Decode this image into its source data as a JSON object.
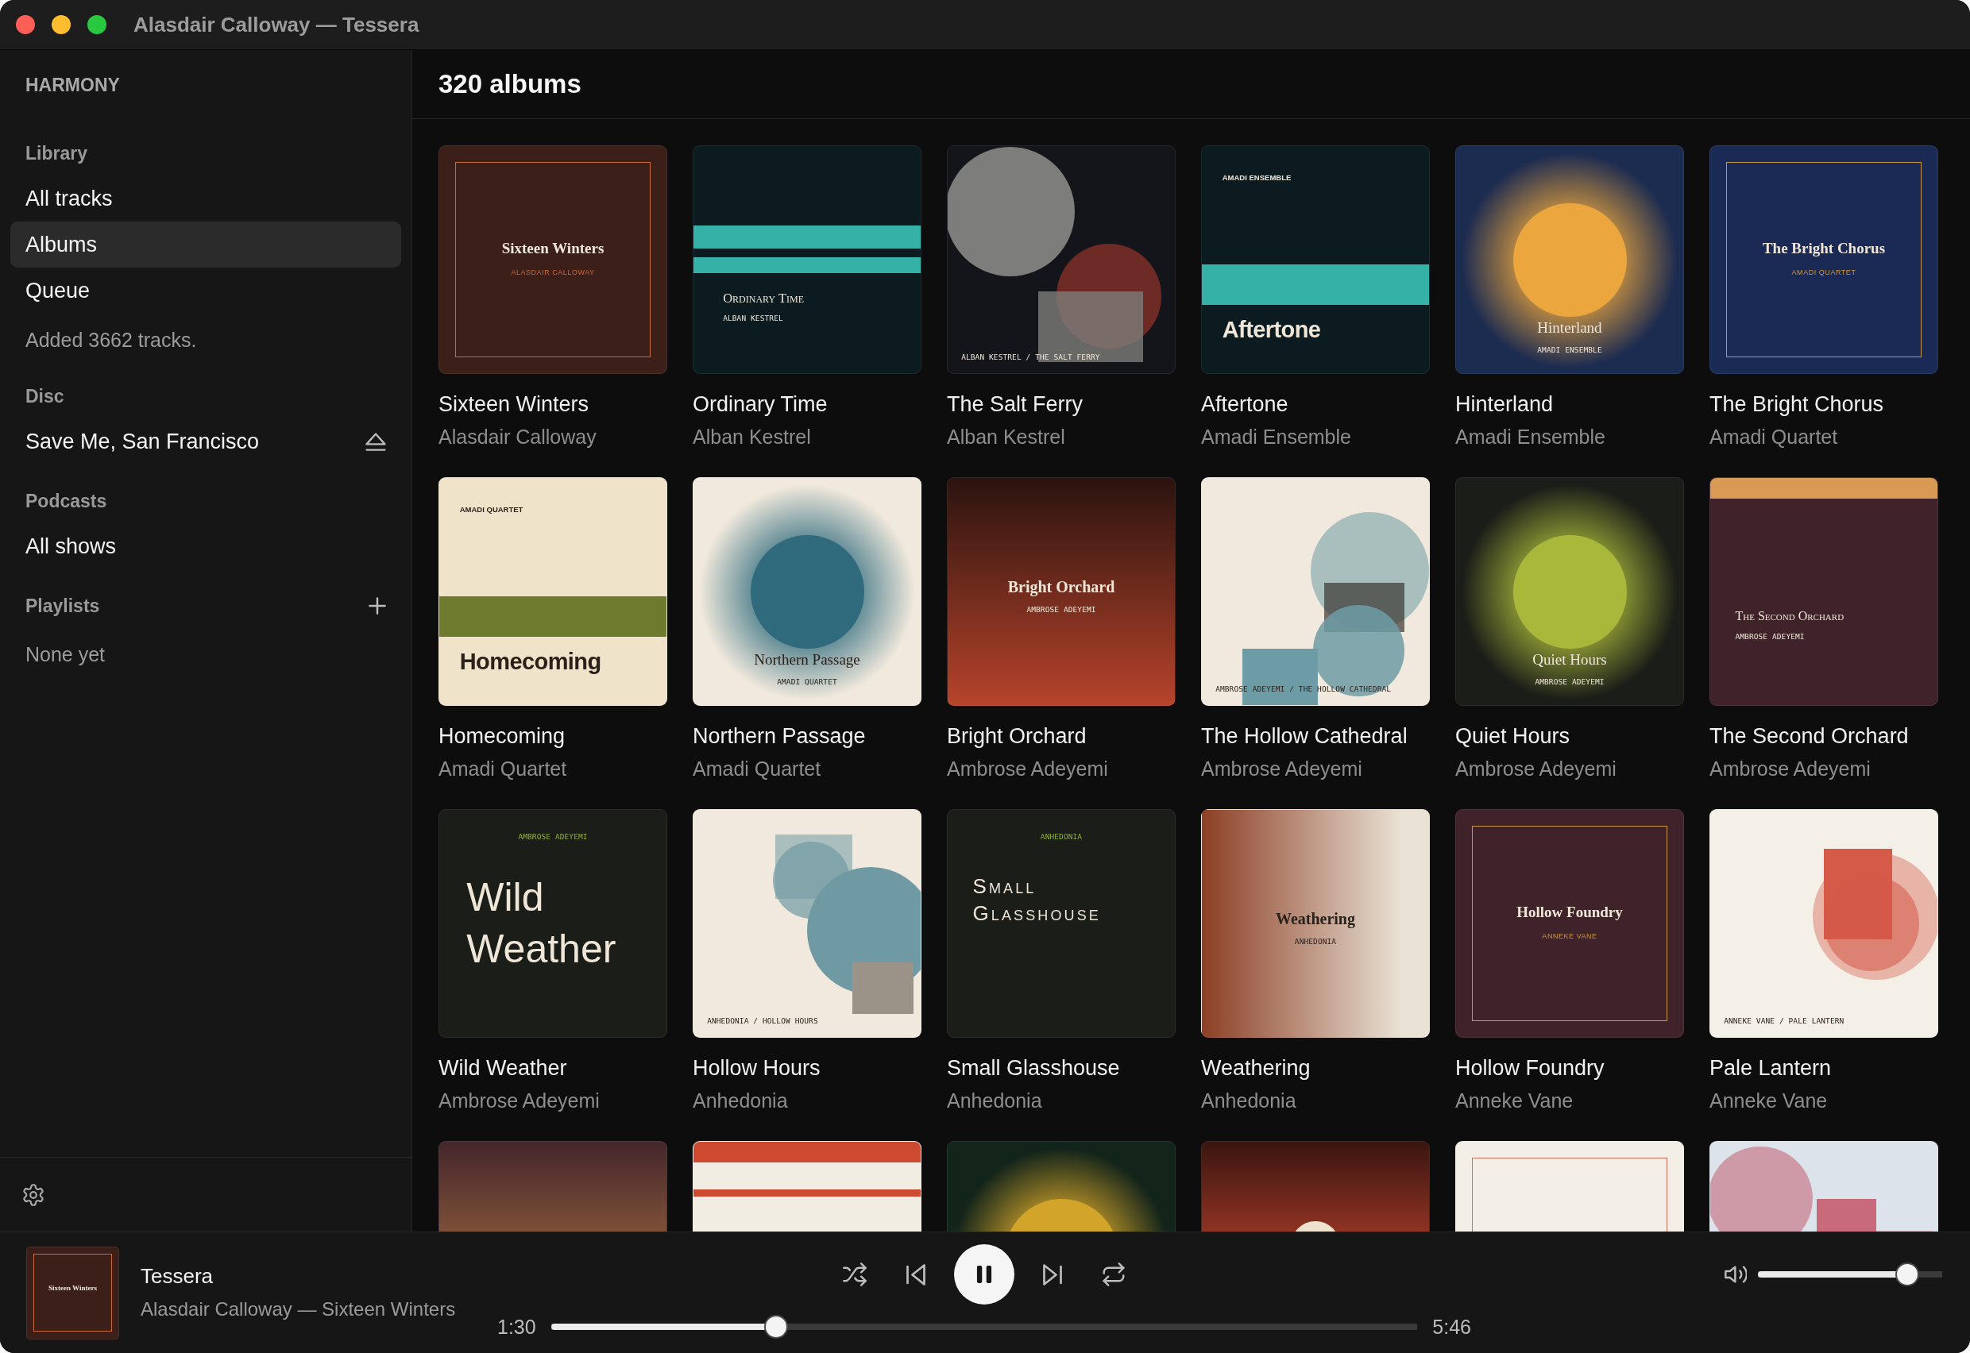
{
  "window": {
    "title": "Alasdair Calloway — Tessera"
  },
  "sidebar": {
    "brand": "HARMONY",
    "sections": [
      {
        "heading": "Library",
        "addable": false,
        "items": [
          {
            "label": "All tracks",
            "selected": false
          },
          {
            "label": "Albums",
            "selected": true
          },
          {
            "label": "Queue",
            "selected": false
          }
        ],
        "note": "Added 3662 tracks."
      },
      {
        "heading": "Disc",
        "addable": false,
        "items": [
          {
            "label": "Save Me, San Francisco",
            "selected": false,
            "ejectable": true
          }
        ]
      },
      {
        "heading": "Podcasts",
        "addable": false,
        "items": [
          {
            "label": "All shows",
            "selected": false
          }
        ]
      },
      {
        "heading": "Playlists",
        "addable": true,
        "note": "None yet"
      }
    ]
  },
  "main": {
    "heading": "320 albums",
    "albums": [
      {
        "title": "Sixteen Winters",
        "artist": "Alasdair Calloway",
        "cover": {
          "kind": "frame",
          "color": "#3d1f1a",
          "accent": {
            "color": "#c86a3c"
          },
          "title": "Sixteen Winters",
          "credit": "ALASDAIR CALLOWAY"
        }
      },
      {
        "title": "Ordinary Time",
        "artist": "Alban Kestrel",
        "cover": {
          "kind": "stripes",
          "color": "#0b1b20",
          "accent": {
            "color": "#36b1a8"
          },
          "title": "Ordinary Time",
          "credit": "ALBAN KESTREL"
        }
      },
      {
        "title": "The Salt Ferry",
        "artist": "Alban Kestrel",
        "cover": {
          "kind": "eclipse",
          "color": "#14141b",
          "accent": {
            "color": "#6e2a25"
          },
          "shade": {
            "color": "#7d7d7b"
          },
          "caption": "ALBAN KESTREL / THE SALT FERRY"
        }
      },
      {
        "title": "Aftertone",
        "artist": "Amadi Ensemble",
        "cover": {
          "kind": "band",
          "color": "#0b1b20",
          "accent": {
            "color": "#36b1a8"
          },
          "label": "AMADI ENSEMBLE",
          "title": "Aftertone"
        }
      },
      {
        "title": "Hinterland",
        "artist": "Amadi Ensemble",
        "cover": {
          "kind": "sun",
          "color": "#1c2b50",
          "accent": {
            "color": "#eba63e"
          },
          "title": "Hinterland",
          "credit": "AMADI ENSEMBLE"
        }
      },
      {
        "title": "The Bright Chorus",
        "artist": "Amadi Quartet",
        "cover": {
          "kind": "frame",
          "color": "#1b2a55",
          "accent": {
            "color": "#c9973f"
          },
          "title": "The Bright Chorus",
          "credit": "AMADI QUARTET"
        }
      },
      {
        "title": "Homecoming",
        "artist": "Amadi Quartet",
        "cover": {
          "kind": "band",
          "color": "#efe4c9",
          "accent": {
            "color": "#6e7a2e"
          },
          "label": "AMADI QUARTET",
          "title": "Homecoming"
        }
      },
      {
        "title": "Northern Passage",
        "artist": "Amadi Quartet",
        "cover": {
          "kind": "sun",
          "color": "#f1e9dd",
          "accent": {
            "color": "#2f6b7d"
          },
          "title": "Northern Passage",
          "credit": "AMADI QUARTET"
        }
      },
      {
        "title": "Bright Orchard",
        "artist": "Ambrose Adeyemi",
        "cover": {
          "kind": "gradient",
          "color": "#2b130f",
          "accent": {
            "color": "#b8442b"
          },
          "title": "Bright Orchard",
          "credit": "AMBROSE ADEYEMI"
        }
      },
      {
        "title": "The Hollow Cathedral",
        "artist": "Ambrose Adeyemi",
        "cover": {
          "kind": "stack",
          "color": "#f1e9dd",
          "accent": {
            "color": "#6e9ca6"
          },
          "shade": {
            "color": "#a8bfbe"
          },
          "caption": "AMBROSE ADEYEMI / THE HOLLOW CATHEDRAL"
        }
      },
      {
        "title": "Quiet Hours",
        "artist": "Ambrose Adeyemi",
        "cover": {
          "kind": "sun",
          "color": "#1b1d18",
          "accent": {
            "color": "#a9b83b"
          },
          "title": "Quiet Hours",
          "credit": "AMBROSE ADEYEMI"
        }
      },
      {
        "title": "The Second Orchard",
        "artist": "Ambrose Adeyemi",
        "cover": {
          "kind": "topband",
          "color": "#40232a",
          "accent": {
            "color": "#d99a55"
          },
          "title": "The Second Orchard",
          "credit": "AMBROSE ADEYEMI"
        }
      },
      {
        "title": "Wild Weather",
        "artist": "Ambrose Adeyemi",
        "cover": {
          "kind": "poster",
          "color": "#1b1d18",
          "accent": {
            "color": "#8fae3c"
          },
          "credit": "AMBROSE ADEYEMI",
          "title": "Wild Weather"
        }
      },
      {
        "title": "Hollow Hours",
        "artist": "Anhedonia",
        "cover": {
          "kind": "drift",
          "color": "#f1e9dd",
          "accent": {
            "color": "#6f9aa3"
          },
          "shade": {
            "color": "#9b9387"
          },
          "caption": "ANHEDONIA / HOLLOW HOURS"
        }
      },
      {
        "title": "Small Glasshouse",
        "artist": "Anhedonia",
        "cover": {
          "kind": "engraved",
          "color": "#1b1d18",
          "accent": {
            "color": "#8fae3c"
          },
          "credit": "ANHEDONIA",
          "title": "Small Glasshouse"
        }
      },
      {
        "title": "Weathering",
        "artist": "Anhedonia",
        "cover": {
          "kind": "fade",
          "color": "#e9e2d5",
          "accent": {
            "color": "#8c3f25"
          },
          "title": "Weathering",
          "credit": "ANHEDONIA"
        }
      },
      {
        "title": "Hollow Foundry",
        "artist": "Anneke Vane",
        "cover": {
          "kind": "frame",
          "color": "#40232a",
          "accent": {
            "color": "#c9973f"
          },
          "title": "Hollow Foundry",
          "credit": "ANNEKE VANE"
        }
      },
      {
        "title": "Pale Lantern",
        "artist": "Anneke Vane",
        "cover": {
          "kind": "lantern",
          "color": "#f4f0e7",
          "accent": {
            "color": "#d55a48"
          },
          "caption": "ANNEKE VANE / PALE LANTERN"
        }
      },
      {
        "cover": {
          "kind": "gradient",
          "color": "#45262b",
          "accent": {
            "color": "#7d5038"
          }
        }
      },
      {
        "cover": {
          "kind": "banner",
          "color": "#f1ede3",
          "accent": {
            "color": "#cc4a30"
          }
        }
      },
      {
        "cover": {
          "kind": "sun",
          "color": "#13241a",
          "accent": {
            "color": "#d2a42a"
          }
        }
      },
      {
        "cover": {
          "kind": "dusk",
          "color": "#3a1510",
          "accent": {
            "color": "#8e3322"
          },
          "shade": {
            "color": "#efe2cf"
          }
        }
      },
      {
        "cover": {
          "kind": "frame",
          "color": "#f3efe6",
          "accent": {
            "color": "#d0705a"
          }
        }
      },
      {
        "cover": {
          "kind": "bloom",
          "color": "#dde3ea",
          "accent": {
            "color": "#c86a7a"
          },
          "shade": {
            "color": "#cf9aa8"
          }
        }
      }
    ]
  },
  "player": {
    "cover": {
      "kind": "frame",
      "color": "#3d1f1a",
      "accent": {
        "color": "#c86a3c"
      },
      "title": "Sixteen Winters"
    },
    "title": "Tessera",
    "subtitle": "Alasdair Calloway — Sixteen Winters",
    "playing": true,
    "elapsed": "1:30",
    "progress": {
      "level": 0.26
    },
    "duration": "5:46",
    "volume": {
      "level": 0.81
    }
  }
}
